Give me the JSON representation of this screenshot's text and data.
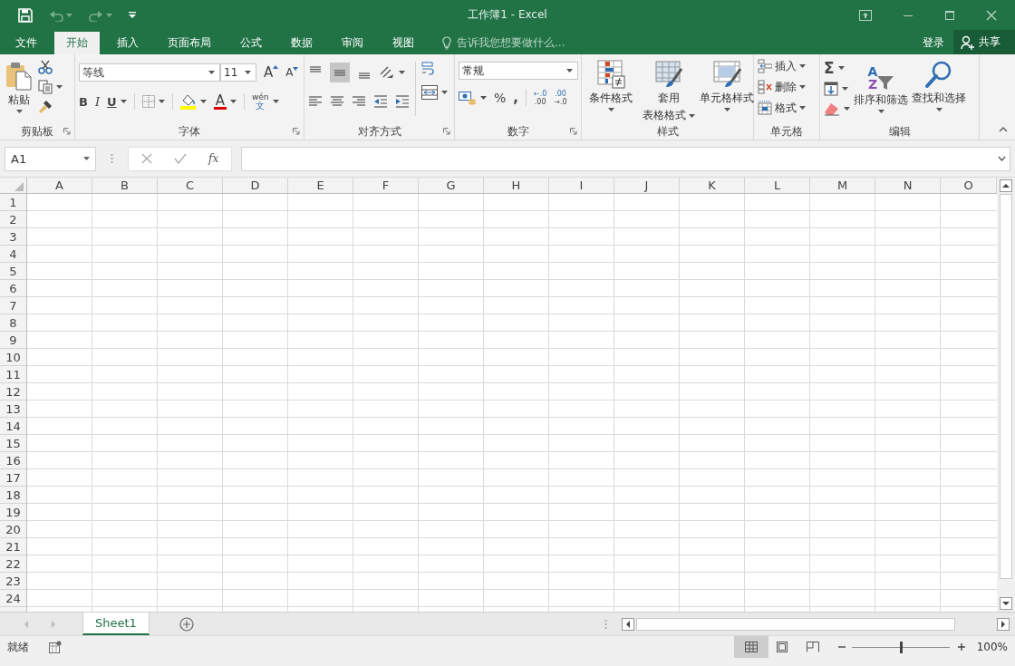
{
  "window": {
    "title": "工作簿1 - Excel"
  },
  "tabs": [
    {
      "label": "文件",
      "selected": false
    },
    {
      "label": "开始",
      "selected": true
    },
    {
      "label": "插入",
      "selected": false
    },
    {
      "label": "页面布局",
      "selected": false
    },
    {
      "label": "公式",
      "selected": false
    },
    {
      "label": "数据",
      "selected": false
    },
    {
      "label": "审阅",
      "selected": false
    },
    {
      "label": "视图",
      "selected": false
    }
  ],
  "tell_me": {
    "placeholder": "告诉我您想要做什么..."
  },
  "account": {
    "sign_in": "登录",
    "share": "共享"
  },
  "ribbon": {
    "clipboard": {
      "label": "剪贴板",
      "paste": "粘贴"
    },
    "font": {
      "label": "字体",
      "font_name": "等线",
      "font_size": "11",
      "grow": "A",
      "shrink": "A",
      "bold": "B",
      "italic": "I",
      "underline": "U",
      "font_color": "A",
      "phonetic": "wén",
      "phonetic_char": "文"
    },
    "alignment": {
      "label": "对齐方式"
    },
    "number": {
      "label": "数字",
      "format": "常规",
      "percent": "%",
      "comma": ",",
      "increase_decimal": [
        "←.0",
        ".00"
      ],
      "decrease_decimal": [
        ".00",
        "→.0"
      ]
    },
    "styles": {
      "label": "样式",
      "buttons": [
        {
          "lines": [
            "条件格式"
          ]
        },
        {
          "lines": [
            "套用",
            "表格格式"
          ]
        },
        {
          "lines": [
            "单元格样式"
          ]
        }
      ]
    },
    "cells": {
      "label": "单元格",
      "buttons": [
        "插入",
        "删除",
        "格式"
      ]
    },
    "editing": {
      "label": "编辑",
      "autosum": "Σ",
      "sort_letters": [
        "A",
        "Z"
      ],
      "buttons": [
        "排序和筛选",
        "查找和选择"
      ]
    }
  },
  "formula_bar": {
    "name_box": "A1",
    "fx": "fx"
  },
  "sheet": {
    "columns": [
      "A",
      "B",
      "C",
      "D",
      "E",
      "F",
      "G",
      "H",
      "I",
      "J",
      "K",
      "L",
      "M",
      "N",
      "O"
    ],
    "rows": [
      "1",
      "2",
      "3",
      "4",
      "5",
      "6",
      "7",
      "8",
      "9",
      "10",
      "11",
      "12",
      "13",
      "14",
      "15",
      "16",
      "17",
      "18",
      "19",
      "20",
      "21",
      "22",
      "23",
      "24"
    ]
  },
  "sheet_tabs": [
    {
      "label": "Sheet1",
      "selected": true
    }
  ],
  "status_bar": {
    "status": "就绪",
    "views": [
      {
        "kind": "normal",
        "selected": true
      },
      {
        "kind": "page_layout",
        "selected": false
      },
      {
        "kind": "page_break",
        "selected": false
      }
    ],
    "zoom": {
      "level": 0.5,
      "reading": "100%"
    }
  }
}
